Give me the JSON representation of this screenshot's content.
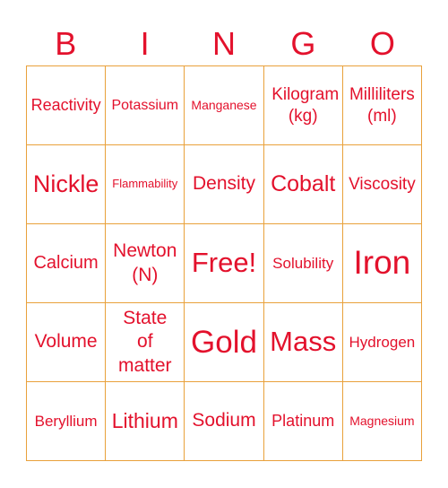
{
  "header": [
    "B",
    "I",
    "N",
    "G",
    "O"
  ],
  "cells": [
    "Reactivity",
    "Potassium",
    "Manganese",
    "Kilogram (kg)",
    "Milliliters (ml)",
    "Nickle",
    "Flammability",
    "Density",
    "Cobalt",
    "Viscosity",
    "Calcium",
    "Newton (N)",
    "Free!",
    "Solubility",
    "Iron",
    "Volume",
    "State of matter",
    "Gold",
    "Mass",
    "Hydrogen",
    "Beryllium",
    "Lithium",
    "Sodium",
    "Platinum",
    "Magnesium"
  ],
  "colors": {
    "text": "#e3112c",
    "border": "#e9a13b"
  }
}
